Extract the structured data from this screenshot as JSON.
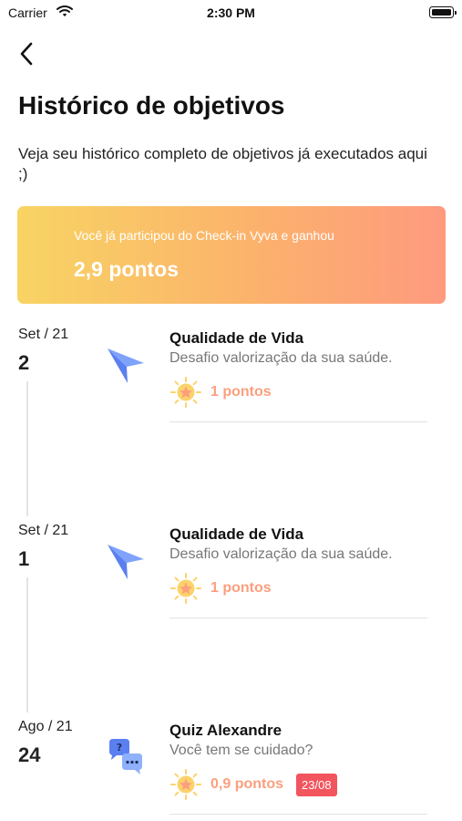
{
  "status_bar": {
    "carrier": "Carrier",
    "time": "2:30 PM"
  },
  "header": {
    "title": "Histórico de objetivos",
    "subtitle": "Veja seu histórico completo de objetivos já executados aqui ;)"
  },
  "points_card": {
    "label": "Você já participou do Check-in Vyva e ganhou",
    "value": "2,9 pontos"
  },
  "entries": [
    {
      "month": "Set / 21",
      "day": "2",
      "icon": "paper-plane-icon",
      "title": "Qualidade de Vida",
      "description": "Desafio valorização da sua saúde.",
      "points": "1 pontos",
      "badge": ""
    },
    {
      "month": "Set / 21",
      "day": "1",
      "icon": "paper-plane-icon",
      "title": "Qualidade de Vida",
      "description": "Desafio valorização da sua saúde.",
      "points": "1 pontos",
      "badge": ""
    },
    {
      "month": "Ago / 21",
      "day": "24",
      "icon": "chat-bubbles-icon",
      "title": "Quiz Alexandre",
      "description": "Você tem se cuidado?",
      "points": "0,9 pontos",
      "badge": "23/08"
    }
  ],
  "colors": {
    "card_gradient": [
      "#f8d463",
      "#fbb26c",
      "#fe9a7f"
    ],
    "points_text": "#fb9f7f",
    "badge": "#f2555e",
    "plane_icon": "#6c8ff5"
  }
}
